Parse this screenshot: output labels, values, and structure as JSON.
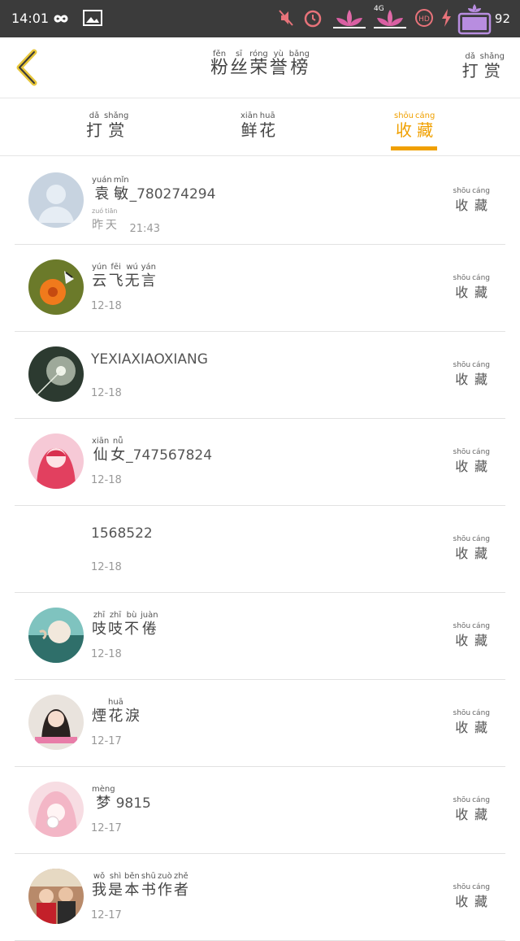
{
  "status_bar": {
    "time": "14:01",
    "battery": "92",
    "icons": [
      "infinity-icon",
      "gallery-icon",
      "mute-icon",
      "alarm-icon",
      "signal-4g-icon",
      "hd-icon",
      "charging-icon",
      "battery-icon"
    ],
    "network_label": "4G"
  },
  "header": {
    "title": [
      {
        "py": "fěn",
        "hz": "粉"
      },
      {
        "py": "sī",
        "hz": "丝"
      },
      {
        "py": "róng",
        "hz": "荣"
      },
      {
        "py": "yù",
        "hz": "誉"
      },
      {
        "py": "bǎng",
        "hz": "榜"
      }
    ],
    "right_action": [
      {
        "py": "dǎ",
        "hz": "打"
      },
      {
        "py": "shǎng",
        "hz": "赏"
      }
    ]
  },
  "tabs": [
    {
      "chars": [
        {
          "py": "dǎ",
          "hz": "打"
        },
        {
          "py": "shǎng",
          "hz": "赏"
        }
      ],
      "active": false
    },
    {
      "chars": [
        {
          "py": "xiān",
          "hz": "鲜"
        },
        {
          "py": "huā",
          "hz": "花"
        }
      ],
      "active": false
    },
    {
      "chars": [
        {
          "py": "shōu",
          "hz": "收"
        },
        {
          "py": "cáng",
          "hz": "藏"
        }
      ],
      "active": true
    }
  ],
  "action_label": [
    {
      "py": "shōu",
      "hz": "收"
    },
    {
      "py": "cáng",
      "hz": "藏"
    }
  ],
  "accent_color": "#f0a000",
  "rows": [
    {
      "name_chars": [
        {
          "py": "yuán",
          "hz": "袁"
        },
        {
          "py": "mǐn",
          "hz": "敏"
        }
      ],
      "name_suffix": "_780274294",
      "date_chars": [
        {
          "py": "zuó",
          "hz": "昨"
        },
        {
          "py": "tiān",
          "hz": "天"
        }
      ],
      "date": "21:43",
      "avatar": "default"
    },
    {
      "name_chars": [
        {
          "py": "yún",
          "hz": "云"
        },
        {
          "py": "fēi",
          "hz": "飞"
        },
        {
          "py": "wú",
          "hz": "无"
        },
        {
          "py": "yán",
          "hz": "言"
        }
      ],
      "name_suffix": "",
      "date_chars": [],
      "date": "12-18",
      "avatar": "flower"
    },
    {
      "name_chars": [],
      "name_suffix": "YEXIAXIAOXIANG",
      "date_chars": [],
      "date": "12-18",
      "avatar": "dandelion"
    },
    {
      "name_chars": [
        {
          "py": "xiān",
          "hz": "仙"
        },
        {
          "py": "nǚ",
          "hz": "女"
        }
      ],
      "name_suffix": "_747567824",
      "date_chars": [],
      "date": "12-18",
      "avatar": "anime-pink"
    },
    {
      "name_chars": [],
      "name_suffix": "1568522",
      "date_chars": [],
      "date": "12-18",
      "avatar": "none"
    },
    {
      "name_chars": [
        {
          "py": "zhī",
          "hz": "吱"
        },
        {
          "py": "zhī",
          "hz": "吱"
        },
        {
          "py": "bù",
          "hz": "不"
        },
        {
          "py": "juàn",
          "hz": "倦"
        }
      ],
      "name_suffix": "",
      "date_chars": [],
      "date": "12-18",
      "avatar": "teal"
    },
    {
      "name_chars": [
        {
          "py": "",
          "hz": "煙"
        },
        {
          "py": "huā",
          "hz": "花"
        },
        {
          "py": "",
          "hz": "淚"
        }
      ],
      "name_suffix": "",
      "date_chars": [],
      "date": "12-17",
      "avatar": "girl"
    },
    {
      "name_chars": [
        {
          "py": "mèng",
          "hz": "梦"
        }
      ],
      "name_suffix": "9815",
      "date_chars": [],
      "date": "12-17",
      "avatar": "anime-light"
    },
    {
      "name_chars": [
        {
          "py": "wǒ",
          "hz": "我"
        },
        {
          "py": "shì",
          "hz": "是"
        },
        {
          "py": "běn",
          "hz": "本"
        },
        {
          "py": "shū",
          "hz": "书"
        },
        {
          "py": "zuò",
          "hz": "作"
        },
        {
          "py": "zhě",
          "hz": "者"
        }
      ],
      "name_suffix": "",
      "date_chars": [],
      "date": "12-17",
      "avatar": "photo"
    }
  ]
}
